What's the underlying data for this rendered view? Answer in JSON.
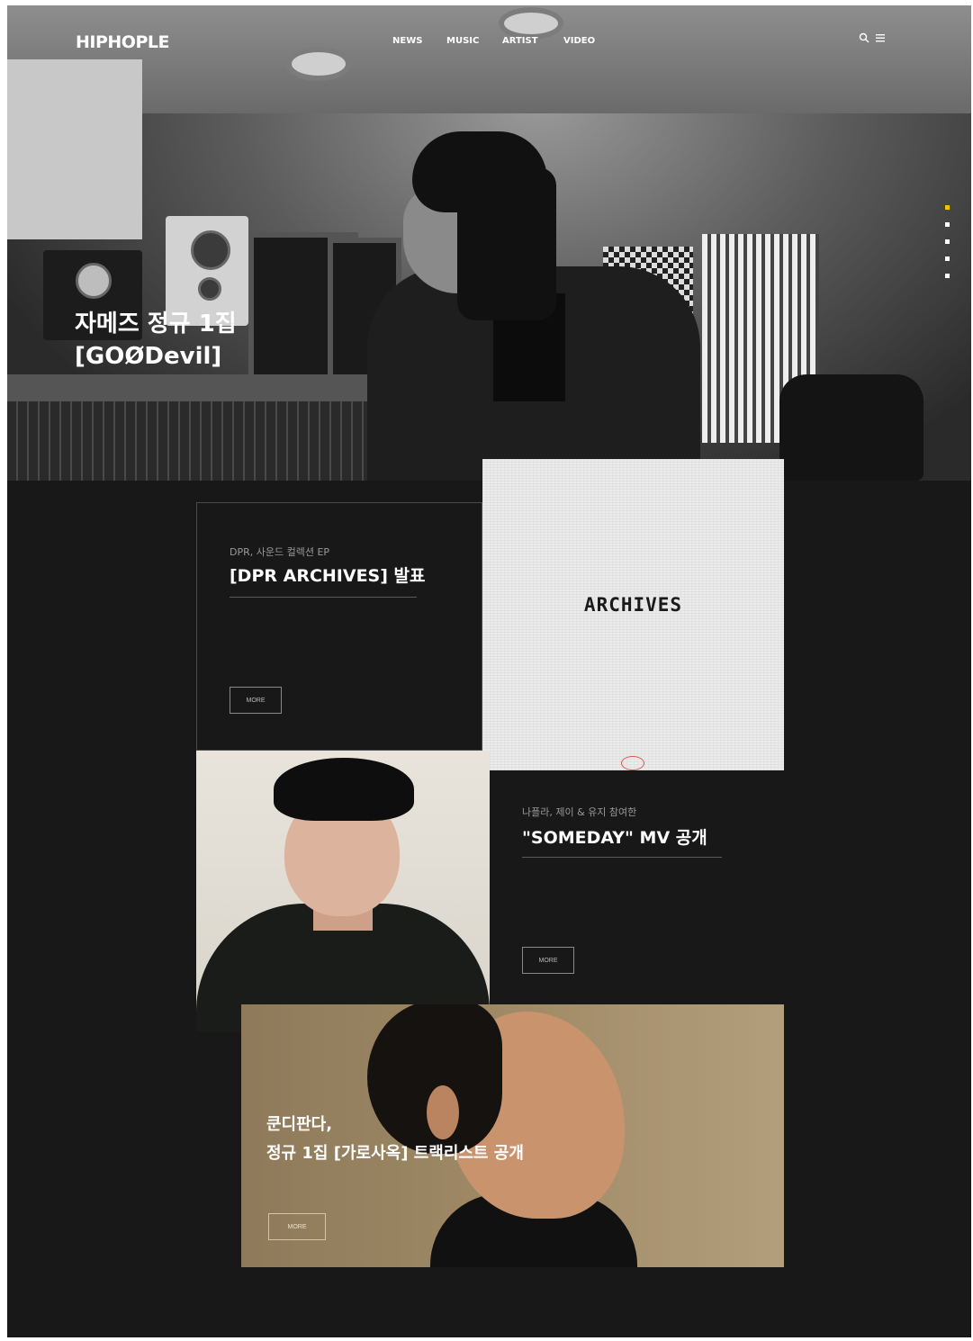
{
  "nav": {
    "logo": "HIPHOPLE",
    "menu": [
      "NEWS",
      "MUSIC",
      "ARTIST",
      "VIDEO"
    ],
    "search_icon": "search-icon",
    "menu_icon": "hamburger-icon"
  },
  "hero": {
    "title_line1": "자메즈 정규 1집",
    "title_line2": "[GOØDevil]",
    "sub_line1": "",
    "sub_line2": "",
    "slide_indicators": 5,
    "active_indicator": 0,
    "accent_color": "#f2c400"
  },
  "card1": {
    "eyebrow": "DPR, 사운드 컬렉션 EP",
    "title": "[DPR ARCHIVES] 발표",
    "body": [
      "",
      "",
      "",
      ""
    ],
    "more": "MORE"
  },
  "archives": {
    "word": "ARCHIVES"
  },
  "card2": {
    "eyebrow": "나플라, 제이 & 유지 참여한",
    "title": "\"SOMEDAY\" MV 공개",
    "body": [
      "",
      "",
      "",
      ""
    ],
    "more": "MORE"
  },
  "card3": {
    "title_line1": "쿤디판다,",
    "title_line2": "정규 1집 [가로사옥] 트랙리스트 공개",
    "body": [
      "",
      ""
    ],
    "more": "MORE"
  },
  "colors": {
    "background": "#181818",
    "frame": "#ffffff"
  }
}
